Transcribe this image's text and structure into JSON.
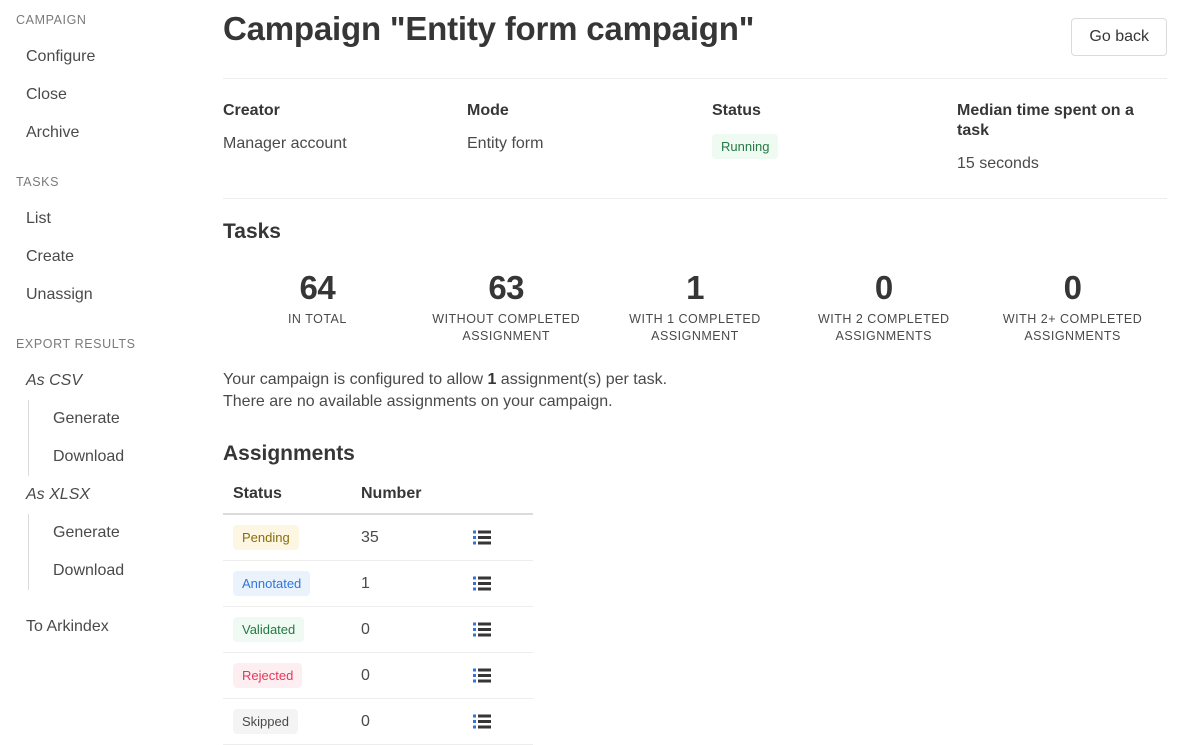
{
  "sidebar": {
    "sections": [
      {
        "label": "CAMPAIGN",
        "items": [
          {
            "label": "Configure"
          },
          {
            "label": "Close"
          },
          {
            "label": "Archive"
          }
        ]
      },
      {
        "label": "TASKS",
        "items": [
          {
            "label": "List"
          },
          {
            "label": "Create"
          },
          {
            "label": "Unassign"
          }
        ]
      }
    ],
    "export_label": "EXPORT RESULTS",
    "export_groups": [
      {
        "label": "As CSV",
        "items": [
          {
            "label": "Generate"
          },
          {
            "label": "Download"
          }
        ]
      },
      {
        "label": "As XLSX",
        "items": [
          {
            "label": "Generate"
          },
          {
            "label": "Download"
          }
        ]
      }
    ],
    "arkindex_label": "To Arkindex"
  },
  "header": {
    "title": "Campaign \"Entity form campaign\"",
    "go_back_label": "Go back"
  },
  "meta": [
    {
      "title": "Creator",
      "value": "Manager account",
      "type": "text"
    },
    {
      "title": "Mode",
      "value": "Entity form",
      "type": "text"
    },
    {
      "title": "Status",
      "value": "Running",
      "type": "tag",
      "tag_class": "tag-running"
    },
    {
      "title": "Median time spent on a task",
      "value": "15 seconds",
      "type": "text"
    }
  ],
  "tasks": {
    "title": "Tasks",
    "stats": [
      {
        "value": "64",
        "label": "IN TOTAL"
      },
      {
        "value": "63",
        "label": "WITHOUT COMPLETED ASSIGNMENT"
      },
      {
        "value": "1",
        "label": "WITH 1 COMPLETED ASSIGNMENT"
      },
      {
        "value": "0",
        "label": "WITH 2 COMPLETED ASSIGNMENTS"
      },
      {
        "value": "0",
        "label": "WITH 2+ COMPLETED ASSIGNMENTS"
      }
    ],
    "note_line1_before": "Your campaign is configured to allow ",
    "note_line1_strong": "1",
    "note_line1_after": " assignment(s) per task.",
    "note_line2": "There are no available assignments on your campaign."
  },
  "assignments": {
    "title": "Assignments",
    "columns": [
      "Status",
      "Number",
      ""
    ],
    "rows": [
      {
        "status": "Pending",
        "tag_class": "tag-pending",
        "number": "35",
        "action_icon": "list-icon"
      },
      {
        "status": "Annotated",
        "tag_class": "tag-annotated",
        "number": "1",
        "action_icon": "list-icon"
      },
      {
        "status": "Validated",
        "tag_class": "tag-validated",
        "number": "0",
        "action_icon": "list-icon"
      },
      {
        "status": "Rejected",
        "tag_class": "tag-rejected",
        "number": "0",
        "action_icon": "list-icon"
      },
      {
        "status": "Skipped",
        "tag_class": "tag-skipped",
        "number": "0",
        "action_icon": "list-icon"
      }
    ]
  },
  "colors": {
    "text": "#363636",
    "muted": "#4a4a4a",
    "label": "#7a7a7a",
    "border": "#dbdbdb",
    "link": "#3273dc",
    "green": "#257942",
    "red": "#e8375a",
    "amber": "#8a6d0b"
  }
}
